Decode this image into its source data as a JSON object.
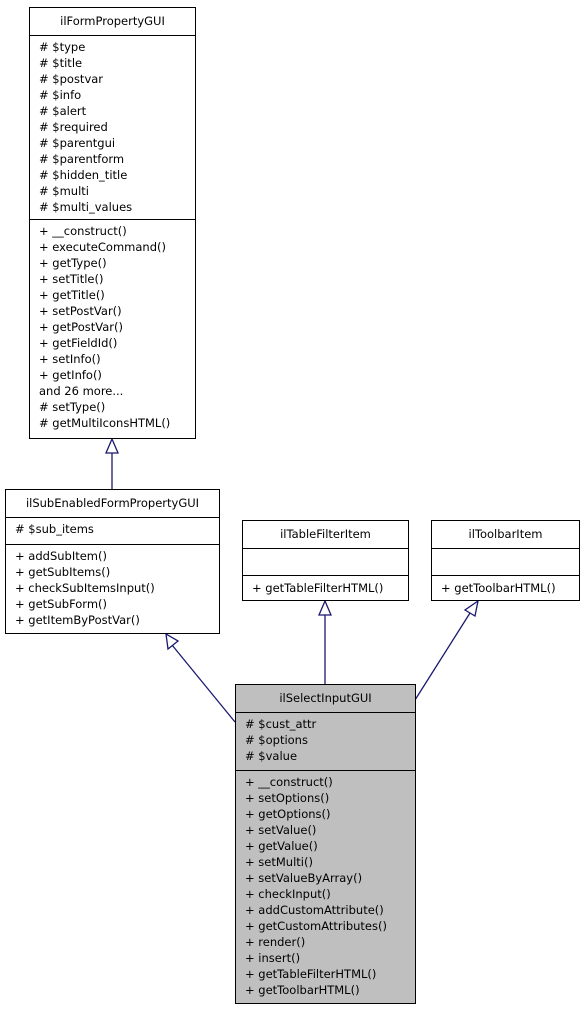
{
  "diagram": {
    "classes": [
      {
        "id": "form-property",
        "name": "ilFormPropertyGUI",
        "attributes": [
          "# $type",
          "# $title",
          "# $postvar",
          "# $info",
          "# $alert",
          "# $required",
          "# $parentgui",
          "# $parentform",
          "# $hidden_title",
          "# $multi",
          "# $multi_values"
        ],
        "methods": [
          "+ __construct()",
          "+ executeCommand()",
          "+ getType()",
          "+ setTitle()",
          "+ getTitle()",
          "+ setPostVar()",
          "+ getPostVar()",
          "+ getFieldId()",
          "+ setInfo()",
          "+ getInfo()",
          "and 26 more...",
          "# setType()",
          "# getMultiIconsHTML()"
        ]
      },
      {
        "id": "sub-enabled",
        "name": "ilSubEnabledFormPropertyGUI",
        "attributes": [
          "# $sub_items"
        ],
        "methods": [
          "+ addSubItem()",
          "+ getSubItems()",
          "+ checkSubItemsInput()",
          "+ getSubForm()",
          "+ getItemByPostVar()"
        ]
      },
      {
        "id": "table-filter",
        "name": "ilTableFilterItem",
        "attributes": [],
        "methods": [
          "+ getTableFilterHTML()"
        ]
      },
      {
        "id": "toolbar-item",
        "name": "ilToolbarItem",
        "attributes": [],
        "methods": [
          "+ getToolbarHTML()"
        ]
      },
      {
        "id": "select-input",
        "name": "ilSelectInputGUI",
        "attributes": [
          "# $cust_attr",
          "# $options",
          "# $value"
        ],
        "methods": [
          "+ __construct()",
          "+ setOptions()",
          "+ getOptions()",
          "+ setValue()",
          "+ getValue()",
          "+ setMulti()",
          "+ setValueByArray()",
          "+ checkInput()",
          "+ addCustomAttribute()",
          "+ getCustomAttributes()",
          "+ render()",
          "+ insert()",
          "+ getTableFilterHTML()",
          "+ getToolbarHTML()"
        ]
      }
    ],
    "inheritance": [
      {
        "from": "sub-enabled",
        "to": "form-property"
      },
      {
        "from": "select-input",
        "to": "sub-enabled"
      },
      {
        "from": "select-input",
        "to": "table-filter"
      },
      {
        "from": "select-input",
        "to": "toolbar-item"
      }
    ],
    "colors": {
      "edge": "#191970",
      "focus_fill": "#bfbfbf",
      "border": "#000000"
    }
  }
}
